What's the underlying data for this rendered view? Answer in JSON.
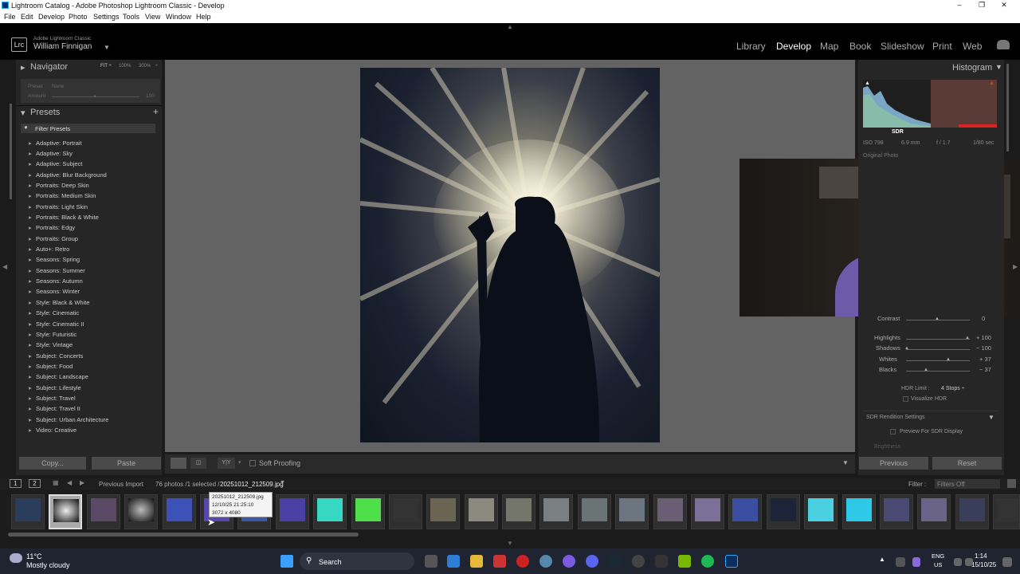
{
  "window": {
    "title": "Lightroom Catalog - Adobe Photoshop Lightroom Classic - Develop"
  },
  "menu": [
    "File",
    "Edit",
    "Develop",
    "Photo",
    "Settings",
    "Tools",
    "View",
    "Window",
    "Help"
  ],
  "identity": {
    "app_label": "Adobe Lightroom Classic",
    "user": "William Finnigan",
    "logo": "Lrc"
  },
  "modules": [
    "Library",
    "Develop",
    "Map",
    "Book",
    "Slideshow",
    "Print",
    "Web"
  ],
  "navigator": {
    "title": "Navigator",
    "zoom": [
      "FIT ÷",
      "100%",
      "300%"
    ]
  },
  "preset_box": {
    "preset_label": "Preset",
    "preset_value": "None",
    "amount_label": "Amount",
    "amount_value": "100"
  },
  "presets": {
    "title": "Presets",
    "filter": "Filter Presets",
    "items": [
      "Adaptive: Portrait",
      "Adaptive: Sky",
      "Adaptive: Subject",
      "Adaptive: Blur Background",
      "Portraits: Deep Skin",
      "Portraits: Medium Skin",
      "Portraits: Light Skin",
      "Portraits: Black & White",
      "Portraits: Edgy",
      "Portraits: Group",
      "Auto+: Retro",
      "Seasons: Spring",
      "Seasons: Summer",
      "Seasons: Autumn",
      "Seasons: Winter",
      "Style: Black & White",
      "Style: Cinematic",
      "Style: Cinematic II",
      "Style: Futuristic",
      "Style: Vintage",
      "Subject: Concerts",
      "Subject: Food",
      "Subject: Landscape",
      "Subject: Lifestyle",
      "Subject: Travel",
      "Subject: Travel II",
      "Subject: Urban Architecture",
      "Video: Creative"
    ]
  },
  "copy_paste": {
    "copy": "Copy...",
    "paste": "Paste"
  },
  "toolbar": {
    "soft_proofing": "Soft Proofing"
  },
  "histogram": {
    "title": "Histogram",
    "sdr": "SDR",
    "iso": "ISO 798",
    "focal": "6.9 mm",
    "aperture": "f / 1.7",
    "shutter": "1/80 sec",
    "original": "Original Photo"
  },
  "basic": {
    "contrast_label": "Contrast",
    "contrast_value": "0",
    "highlights_label": "Highlights",
    "highlights_value": "+ 100",
    "shadows_label": "Shadows",
    "shadows_value": "− 100",
    "whites_label": "Whites",
    "whites_value": "+ 37",
    "blacks_label": "Blacks",
    "blacks_value": "− 37",
    "hdr_limit_label": "HDR Limit :",
    "hdr_limit_value": "4 Stops ÷",
    "visualize_hdr": "Visualize HDR",
    "sdr_rendition": "SDR Rendition Settings",
    "preview_sdr": "Preview For SDR Display",
    "brightness": "Brightness"
  },
  "nav_buttons": {
    "previous": "Previous",
    "reset": "Reset"
  },
  "filmstrip_bar": {
    "screen1": "1",
    "screen2": "2",
    "source": "Previous Import",
    "count": "76 photos /1 selected /",
    "file": "20251012_212509.jpg",
    "filter_label": "Filter :",
    "filter_value": "Filters Off"
  },
  "tooltip": {
    "file": "20251012_212509.jpg",
    "date": "12/10/25 21:25:10",
    "size": "3072 x 4080"
  },
  "taskbar": {
    "temp": "11°C",
    "weather": "Mostly cloudy",
    "search": "Search",
    "lang": "ENG",
    "region": "US",
    "time": "1:14",
    "date": "15/10/25"
  }
}
